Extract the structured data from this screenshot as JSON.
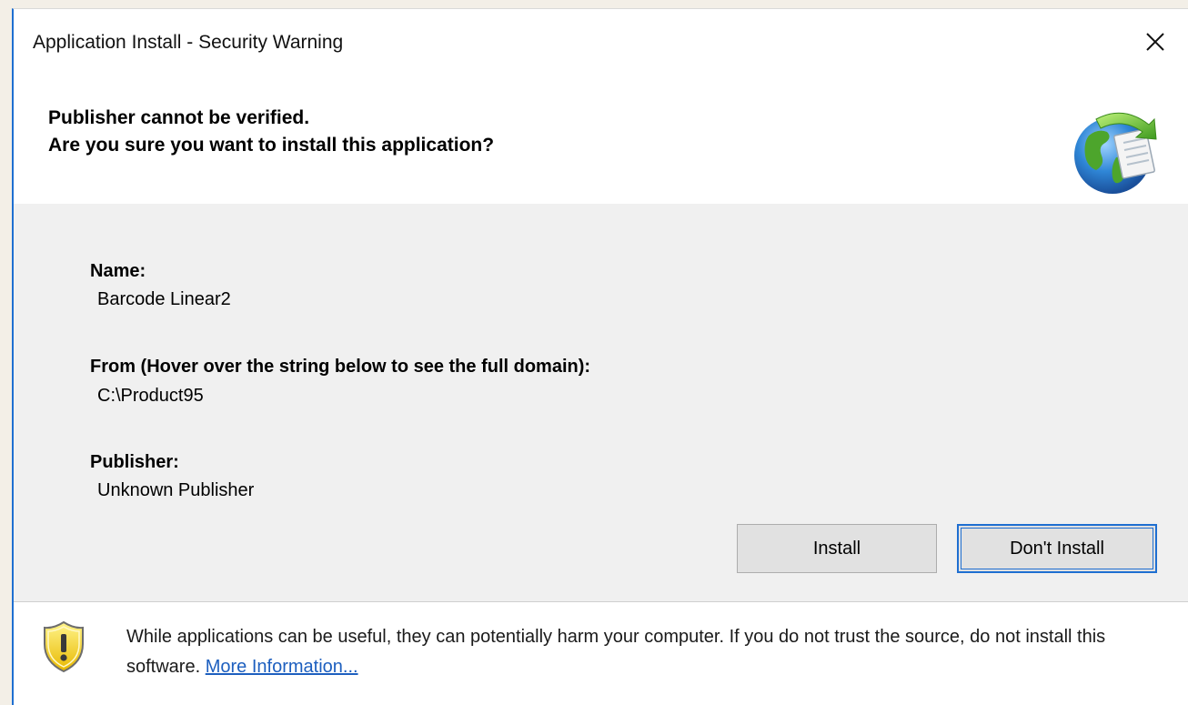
{
  "window": {
    "title": "Application Install - Security Warning",
    "close_icon": "close-icon"
  },
  "header": {
    "line1": "Publisher cannot be verified.",
    "line2": "Are you sure you want to install this application?",
    "icon": "globe-install-icon"
  },
  "details": {
    "name_label": "Name:",
    "name_value": "Barcode Linear2",
    "from_label": "From (Hover over the string below to see the full domain):",
    "from_value": "C:\\Product95",
    "publisher_label": "Publisher:",
    "publisher_value": "Unknown Publisher"
  },
  "buttons": {
    "install_label": "Install",
    "dont_install_label": "Don't Install"
  },
  "footer": {
    "warning_icon": "warning-shield-icon",
    "message": "While applications can be useful, they can potentially harm your computer. If you do not trust the source, do not install this software.",
    "link_label": "More Information..."
  },
  "colors": {
    "accent": "#1f6fd1",
    "link": "#1d5fbf",
    "panel_bg": "#f0f0f0"
  }
}
